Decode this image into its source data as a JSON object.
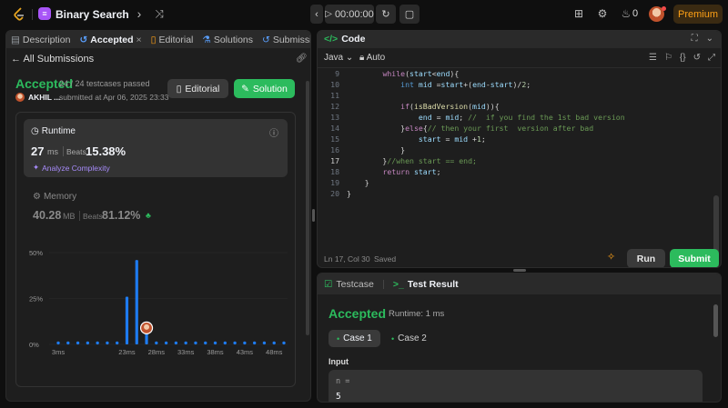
{
  "topbar": {
    "problem_title": "Binary Search",
    "timer": "00:00:00",
    "streak_count": "0",
    "premium_label": "Premium"
  },
  "left_tabs": [
    {
      "label": "Description",
      "icon": "description-icon"
    },
    {
      "label": "Accepted",
      "icon": "history-icon",
      "active": true
    },
    {
      "label": "Editorial",
      "icon": "book-icon"
    },
    {
      "label": "Solutions",
      "icon": "flask-icon"
    },
    {
      "label": "Submissio",
      "icon": "history-icon"
    }
  ],
  "submission": {
    "back_label": "All Submissions",
    "status": "Accepted",
    "testcases": "24 / 24 testcases passed",
    "author": "AKHIL ...",
    "submitted": "submitted at Apr 06, 2025 23:33",
    "editorial_btn": "Editorial",
    "solution_btn": "Solution"
  },
  "runtime": {
    "label": "Runtime",
    "value": "27",
    "unit": "ms",
    "beats_label": "Beats",
    "beats_pct": "15.38%",
    "analyze_label": "Analyze Complexity"
  },
  "memory": {
    "label": "Memory",
    "value": "40.28",
    "unit": "MB",
    "beats_label": "Beats",
    "beats_pct": "81.12%"
  },
  "chart_data": {
    "type": "bar",
    "title": "",
    "xlabel": "",
    "ylabel": "",
    "y_ticks": [
      "50%",
      "25%",
      "0%"
    ],
    "ylim": [
      0,
      50
    ],
    "x_ticks": [
      "3ms",
      "23ms",
      "28ms",
      "33ms",
      "38ms",
      "43ms",
      "48ms"
    ],
    "categories": [
      "3ms",
      "6ms",
      "9ms",
      "12ms",
      "15ms",
      "18ms",
      "21ms",
      "23ms",
      "25ms",
      "27ms",
      "28ms",
      "30ms",
      "32ms",
      "33ms",
      "35ms",
      "37ms",
      "38ms",
      "40ms",
      "42ms",
      "43ms",
      "45ms",
      "47ms",
      "48ms",
      "50ms"
    ],
    "values": [
      0.4,
      0.4,
      0.4,
      0.4,
      0.4,
      0.4,
      0.4,
      26,
      46,
      6,
      0.4,
      0.4,
      0.4,
      0.4,
      0.4,
      0.4,
      0.4,
      0.4,
      0.4,
      0.4,
      0.4,
      0.4,
      0.4,
      0.4
    ],
    "highlight_category": "27ms",
    "bar_color": "#1e7bf0",
    "minimap_ticks": [
      "3ms",
      "28ms",
      "48ms"
    ]
  },
  "code": {
    "title": "Code",
    "language": "Java",
    "mode": "Auto",
    "status": "Ln 17, Col 30",
    "saved": "Saved",
    "run_btn": "Run",
    "submit_btn": "Submit"
  },
  "result": {
    "tab_testcase": "Testcase",
    "tab_result": "Test Result",
    "status": "Accepted",
    "runtime": "Runtime: 1 ms",
    "case1": "Case 1",
    "case2": "Case 2",
    "input_label": "Input",
    "input_var": "n =",
    "input_val": "5"
  },
  "colors": {
    "accent_green": "#2cbb5d",
    "premium_orange": "#ffa116",
    "bar_blue": "#1e7bf0"
  }
}
